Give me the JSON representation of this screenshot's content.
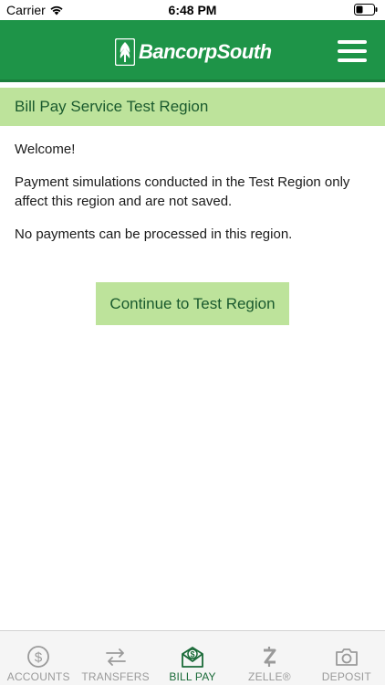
{
  "status_bar": {
    "carrier": "Carrier",
    "time": "6:48 PM"
  },
  "header": {
    "brand": "BancorpSouth",
    "menu_icon": "hamburger-menu-icon"
  },
  "region": {
    "title": "Bill Pay Service Test Region"
  },
  "content": {
    "welcome": "Welcome!",
    "paragraph1": "Payment simulations conducted in the Test Region only affect this region and are not saved.",
    "paragraph2": "No payments can be processed in this region.",
    "continue_label": "Continue to Test Region"
  },
  "tabs": [
    {
      "label": "ACCOUNTS",
      "icon": "dollar-circle-icon",
      "active": false
    },
    {
      "label": "TRANSFERS",
      "icon": "transfer-arrows-icon",
      "active": false
    },
    {
      "label": "BILL PAY",
      "icon": "bill-envelope-icon",
      "active": true
    },
    {
      "label": "ZELLE®",
      "icon": "zelle-icon",
      "active": false
    },
    {
      "label": "DEPOSIT",
      "icon": "camera-icon",
      "active": false
    }
  ],
  "colors": {
    "header_green": "#1e9448",
    "region_bar": "#bde39b",
    "region_text": "#1a5a2e",
    "tab_inactive": "#9a9a9a",
    "tab_active": "#1a6a38"
  }
}
